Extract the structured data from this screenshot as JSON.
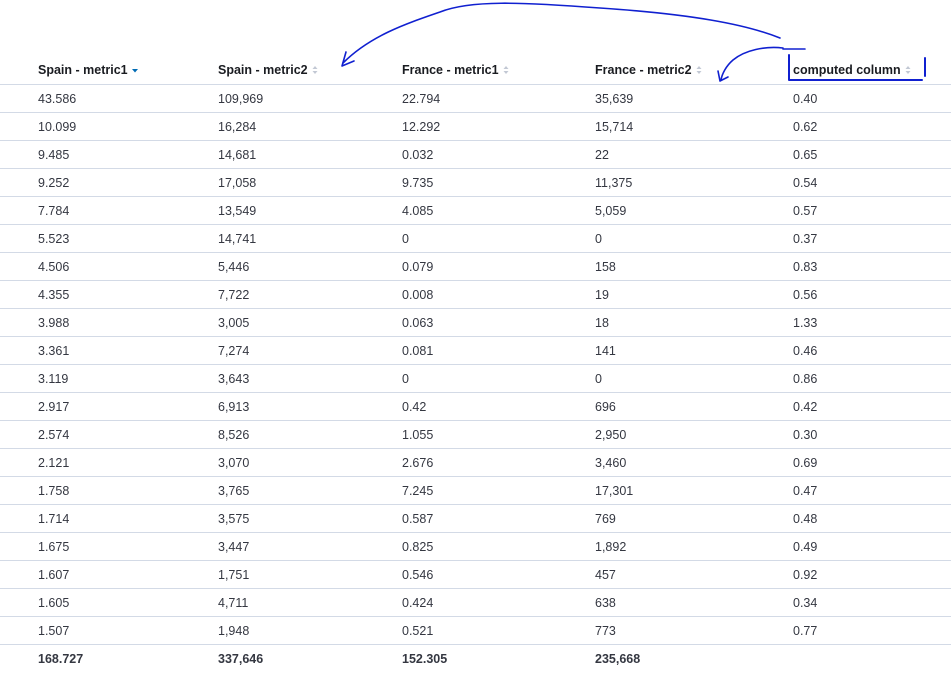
{
  "table": {
    "headers": [
      {
        "label": "Spain - metric1",
        "sort": "desc"
      },
      {
        "label": "Spain - metric2",
        "sort": "none"
      },
      {
        "label": "France - metric1",
        "sort": "none"
      },
      {
        "label": "France - metric2",
        "sort": "none"
      },
      {
        "label": "computed column",
        "sort": "none"
      }
    ],
    "rows": [
      [
        "43.586",
        "109,969",
        "22.794",
        "35,639",
        "0.40"
      ],
      [
        "10.099",
        "16,284",
        "12.292",
        "15,714",
        "0.62"
      ],
      [
        "9.485",
        "14,681",
        "0.032",
        "22",
        "0.65"
      ],
      [
        "9.252",
        "17,058",
        "9.735",
        "11,375",
        "0.54"
      ],
      [
        "7.784",
        "13,549",
        "4.085",
        "5,059",
        "0.57"
      ],
      [
        "5.523",
        "14,741",
        "0",
        "0",
        "0.37"
      ],
      [
        "4.506",
        "5,446",
        "0.079",
        "158",
        "0.83"
      ],
      [
        "4.355",
        "7,722",
        "0.008",
        "19",
        "0.56"
      ],
      [
        "3.988",
        "3,005",
        "0.063",
        "18",
        "1.33"
      ],
      [
        "3.361",
        "7,274",
        "0.081",
        "141",
        "0.46"
      ],
      [
        "3.119",
        "3,643",
        "0",
        "0",
        "0.86"
      ],
      [
        "2.917",
        "6,913",
        "0.42",
        "696",
        "0.42"
      ],
      [
        "2.574",
        "8,526",
        "1.055",
        "2,950",
        "0.30"
      ],
      [
        "2.121",
        "3,070",
        "2.676",
        "3,460",
        "0.69"
      ],
      [
        "1.758",
        "3,765",
        "7.245",
        "17,301",
        "0.47"
      ],
      [
        "1.714",
        "3,575",
        "0.587",
        "769",
        "0.48"
      ],
      [
        "1.675",
        "3,447",
        "0.825",
        "1,892",
        "0.49"
      ],
      [
        "1.607",
        "1,751",
        "0.546",
        "457",
        "0.92"
      ],
      [
        "1.605",
        "4,711",
        "0.424",
        "638",
        "0.34"
      ],
      [
        "1.507",
        "1,948",
        "0.521",
        "773",
        "0.77"
      ]
    ],
    "totals": [
      "168.727",
      "337,646",
      "152.305",
      "235,668",
      ""
    ]
  },
  "colors": {
    "annotation": "#1020d0",
    "active_sort": "#006bb4",
    "inactive_sort": "#c2c8d4"
  }
}
